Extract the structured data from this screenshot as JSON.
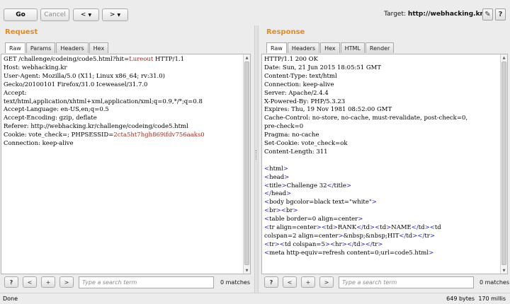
{
  "toolbar": {
    "go_label": "Go",
    "cancel_label": "Cancel",
    "back_label": "<",
    "forward_label": ">",
    "target_prefix": "Target:",
    "target_url": "http://webhacking.kr",
    "edit_icon": "pencil-icon",
    "help_label": "?"
  },
  "request": {
    "title": "Request",
    "tabs": [
      "Raw",
      "Params",
      "Headers",
      "Hex"
    ],
    "active_tab": "Raw",
    "lines": [
      [
        {
          "t": "GET /challenge/codeing/code5.html?hit="
        },
        {
          "t": "Lureout",
          "c": "hl"
        },
        {
          "t": " HTTP/1.1"
        }
      ],
      [
        {
          "t": "Host: webhacking.kr"
        }
      ],
      [
        {
          "t": "User-Agent: Mozilla/5.0 (X11; Linux x86_64; rv:31.0)"
        }
      ],
      [
        {
          "t": "Gecko/20100101 Firefox/31.0 Iceweasel/31.7.0"
        }
      ],
      [
        {
          "t": "Accept:"
        }
      ],
      [
        {
          "t": "text/html,application/xhtml+xml,application/xml;q=0.9,*/*;q=0.8"
        }
      ],
      [
        {
          "t": "Accept-Language: en-US,en;q=0.5"
        }
      ],
      [
        {
          "t": "Accept-Encoding: gzip, deflate"
        }
      ],
      [
        {
          "t": "Referer: http://webhacking.kr/challenge/codeing/code5.html"
        }
      ],
      [
        {
          "t": "Cookie: vote_check=; PHPSESSID="
        },
        {
          "t": "2cta5ht7hgh869ifdv756aaks0",
          "c": "hl"
        }
      ],
      [
        {
          "t": "Connection: keep-alive"
        }
      ]
    ],
    "search": {
      "placeholder": "Type a search term",
      "matches": "0 matches"
    }
  },
  "response": {
    "title": "Response",
    "tabs": [
      "Raw",
      "Headers",
      "Hex",
      "HTML",
      "Render"
    ],
    "active_tab": "Raw",
    "lines": [
      [
        {
          "t": "HTTP/1.1 200 OK"
        }
      ],
      [
        {
          "t": "Date: Sun, 21 Jun 2015 18:05:51 GMT"
        }
      ],
      [
        {
          "t": "Content-Type: text/html"
        }
      ],
      [
        {
          "t": "Connection: keep-alive"
        }
      ],
      [
        {
          "t": "Server: Apache/2.4.4"
        }
      ],
      [
        {
          "t": "X-Powered-By: PHP/5.3.23"
        }
      ],
      [
        {
          "t": "Expires: Thu, 19 Nov 1981 08:52:00 GMT"
        }
      ],
      [
        {
          "t": "Cache-Control: no-store, no-cache, must-revalidate, post-check=0,"
        }
      ],
      [
        {
          "t": "pre-check=0"
        }
      ],
      [
        {
          "t": "Pragma: no-cache"
        }
      ],
      [
        {
          "t": "Set-Cookie: vote_check=ok"
        }
      ],
      [
        {
          "t": "Content-Length: 311"
        }
      ],
      [
        {
          "t": ""
        }
      ],
      [
        {
          "t": "<",
          "c": "tg"
        },
        {
          "t": "html"
        },
        {
          "t": ">",
          "c": "tg"
        }
      ],
      [
        {
          "t": "<",
          "c": "tg"
        },
        {
          "t": "head"
        },
        {
          "t": ">",
          "c": "tg"
        }
      ],
      [
        {
          "t": "<",
          "c": "tg"
        },
        {
          "t": "title"
        },
        {
          "t": ">",
          "c": "tg"
        },
        {
          "t": "Challenge 32"
        },
        {
          "t": "</",
          "c": "tg"
        },
        {
          "t": "title"
        },
        {
          "t": ">",
          "c": "tg"
        }
      ],
      [
        {
          "t": "</",
          "c": "tg"
        },
        {
          "t": "head"
        },
        {
          "t": ">",
          "c": "tg"
        }
      ],
      [
        {
          "t": "<",
          "c": "tg"
        },
        {
          "t": "body bgcolor=black text=\"white\""
        },
        {
          "t": ">",
          "c": "tg"
        }
      ],
      [
        {
          "t": "<",
          "c": "tg"
        },
        {
          "t": "br"
        },
        {
          "t": "><",
          "c": "tg"
        },
        {
          "t": "br"
        },
        {
          "t": ">",
          "c": "tg"
        }
      ],
      [
        {
          "t": "<",
          "c": "tg"
        },
        {
          "t": "table border=0 align=center"
        },
        {
          "t": ">",
          "c": "tg"
        }
      ],
      [
        {
          "t": "<",
          "c": "tg"
        },
        {
          "t": "tr align=center"
        },
        {
          "t": "><",
          "c": "tg"
        },
        {
          "t": "td"
        },
        {
          "t": ">",
          "c": "tg"
        },
        {
          "t": "RANK"
        },
        {
          "t": "</",
          "c": "tg"
        },
        {
          "t": "td"
        },
        {
          "t": "><",
          "c": "tg"
        },
        {
          "t": "td"
        },
        {
          "t": ">",
          "c": "tg"
        },
        {
          "t": "NAME"
        },
        {
          "t": "</",
          "c": "tg"
        },
        {
          "t": "td"
        },
        {
          "t": "><",
          "c": "tg"
        },
        {
          "t": "td"
        }
      ],
      [
        {
          "t": "colspan=2 align=center"
        },
        {
          "t": ">",
          "c": "tg"
        },
        {
          "t": "&nbsp;&nbsp;HIT"
        },
        {
          "t": "</",
          "c": "tg"
        },
        {
          "t": "td"
        },
        {
          "t": "></",
          "c": "tg"
        },
        {
          "t": "tr"
        },
        {
          "t": ">",
          "c": "tg"
        }
      ],
      [
        {
          "t": "<",
          "c": "tg"
        },
        {
          "t": "tr"
        },
        {
          "t": "><",
          "c": "tg"
        },
        {
          "t": "td colspan=5"
        },
        {
          "t": "><",
          "c": "tg"
        },
        {
          "t": "hr"
        },
        {
          "t": "></",
          "c": "tg"
        },
        {
          "t": "td"
        },
        {
          "t": "></",
          "c": "tg"
        },
        {
          "t": "tr"
        },
        {
          "t": ">",
          "c": "tg"
        }
      ],
      [
        {
          "t": "<",
          "c": "tg"
        },
        {
          "t": "meta http-equiv=refresh content=0;url=code5.html"
        },
        {
          "t": ">",
          "c": "tg"
        }
      ]
    ],
    "search": {
      "placeholder": "Type a search term",
      "matches": "0 matches"
    }
  },
  "search_buttons": [
    "?",
    "<",
    "+",
    ">"
  ],
  "status": {
    "left": "Done",
    "bytes": "649 bytes",
    "millis": "170 millis"
  },
  "colors": {
    "accent": "#e58a1f",
    "highlight": "#a5281b",
    "tag": "#1e1ea8"
  }
}
